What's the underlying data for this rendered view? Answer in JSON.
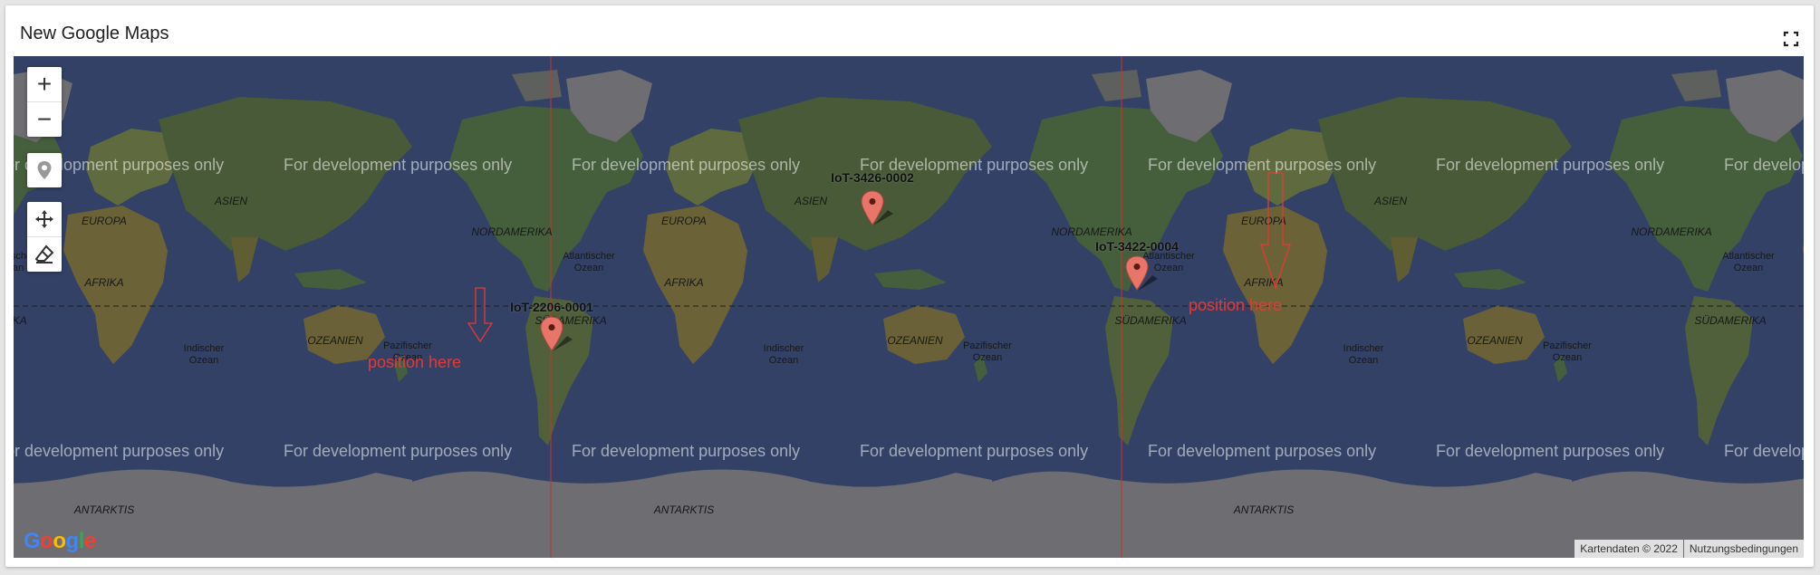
{
  "widget": {
    "title": "New Google Maps"
  },
  "map": {
    "watermark": "For development purposes only",
    "continent_labels": [
      "NORDAMERIKA",
      "EUROPA",
      "ASIEN",
      "AFRIKA",
      "SÜDAMERIKA",
      "OZEANIEN",
      "ANTARKTIS"
    ],
    "ocean_labels": [
      "Atlantischer",
      "Ozean",
      "Indischer",
      "Ozean",
      "Pazifischer",
      "Ozean"
    ],
    "markers": [
      {
        "label": "IoT-2206-0001",
        "color": "#e8756a"
      },
      {
        "label": "IoT-3426-0002",
        "color": "#e8756a"
      },
      {
        "label": "IoT-3422-0004",
        "color": "#e8756a"
      }
    ],
    "position_label": "position here",
    "controls": {
      "zoom_in": "+",
      "zoom_out": "−"
    },
    "attribution": {
      "map_data": "Kartendaten © 2022",
      "terms": "Nutzungsbedingungen"
    },
    "logo": "Google",
    "colors": {
      "ocean": "#3a4a73",
      "land": "#4f6b45",
      "ice": "#7d7d82",
      "dateline": "#e53935",
      "marker": "#e8756a"
    }
  }
}
